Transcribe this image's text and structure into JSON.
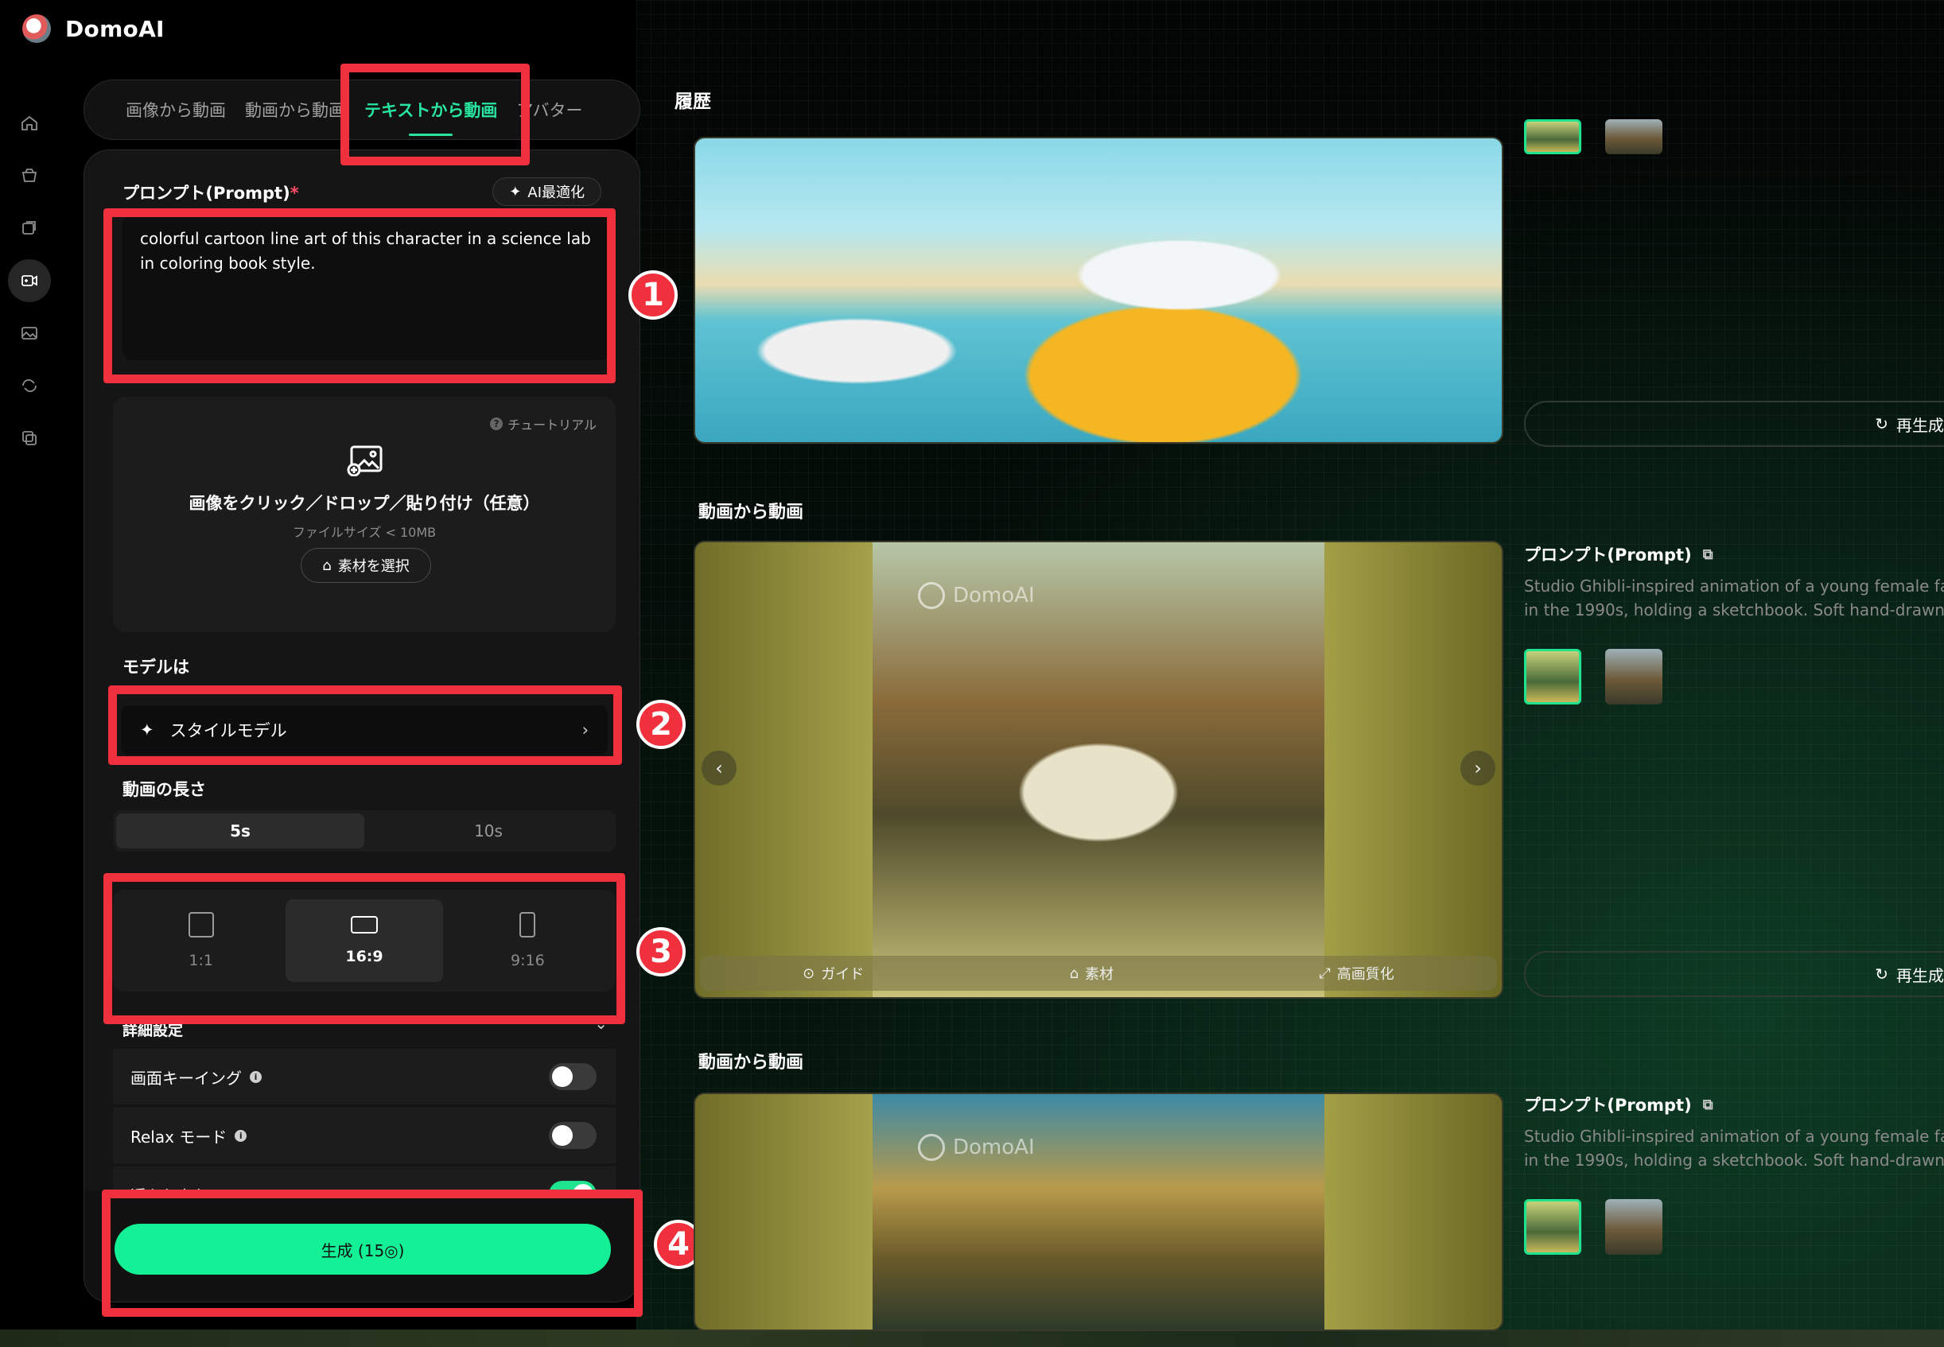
{
  "brand": {
    "name": "DomoAI"
  },
  "nav": {
    "items": [
      "home-icon",
      "archive-icon",
      "layers-icon",
      "video-icon",
      "image-icon",
      "loop-icon",
      "copy-icon"
    ],
    "active_index": 3
  },
  "tabs": [
    {
      "label": "画像から動画",
      "active": false
    },
    {
      "label": "動画から動画",
      "active": false
    },
    {
      "label": "テキストから動画",
      "active": true
    },
    {
      "label": "アバター",
      "active": false
    }
  ],
  "prompt": {
    "label": "プロンプト(Prompt)",
    "required_mark": "*",
    "ai_button": "AI最適化",
    "value": "colorful cartoon line art of this character in a science lab in coloring book style."
  },
  "upload": {
    "tutorial": "チュートリアル",
    "text": "画像をクリック／ドロップ／貼り付け（任意）",
    "sub": "ファイルサイズ < 10MB",
    "button": "素材を選択"
  },
  "model": {
    "label": "モデルは",
    "value": "スタイルモデル"
  },
  "duration": {
    "label": "動画の長さ",
    "options": [
      "5s",
      "10s"
    ],
    "selected": "5s"
  },
  "ratio": {
    "options": [
      "1:1",
      "16:9",
      "9:16"
    ],
    "selected": "16:9"
  },
  "advanced": {
    "label": "詳細設定",
    "toggles": [
      {
        "label": "画面キーイング",
        "on": false
      },
      {
        "label": "Relax モード",
        "on": false
      },
      {
        "label": "透かしなし",
        "on": true
      }
    ]
  },
  "generate": {
    "label": "生成 (15◎)"
  },
  "annotations": [
    "1",
    "2",
    "3",
    "4"
  ],
  "history": {
    "title": "履歴",
    "entries": [
      {
        "title": "",
        "regen": "再生成"
      },
      {
        "title": "動画から動画",
        "prompt_label": "プロンプト(Prompt)",
        "prompt_line1": "Studio Ghibli-inspired animation of a young female fash",
        "prompt_line2": "in the 1990s, holding a sketchbook. Soft hand-drawn",
        "watermark": "DomoAI",
        "bar": [
          "ガイド",
          "素材",
          "高画質化"
        ],
        "regen": "再生成"
      },
      {
        "title": "動画から動画",
        "prompt_label": "プロンプト(Prompt)",
        "prompt_line1": "Studio Ghibli-inspired animation of a young female fash",
        "prompt_line2": "in the 1990s, holding a sketchbook. Soft hand-drawn",
        "watermark": "DomoAI"
      }
    ]
  },
  "colors": {
    "accent": "#14f095",
    "annotation": "#f0313d",
    "panel": "#151515"
  }
}
